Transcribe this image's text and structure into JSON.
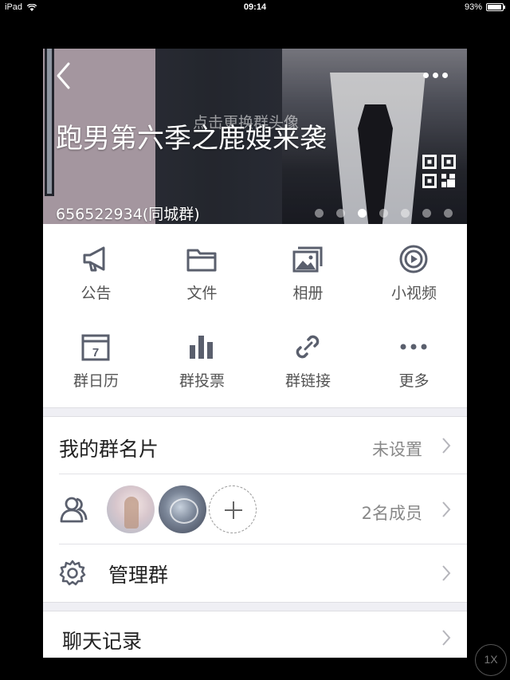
{
  "status_bar": {
    "device": "iPad",
    "time": "09:14",
    "battery_text": "93%",
    "battery_level": 0.93
  },
  "header": {
    "change_avatar_hint": "点击更换群头像",
    "group_name": "跑男第六季之鹿嫂来袭",
    "group_id": "656522934(同城群)",
    "carousel_page_count": 7,
    "carousel_active_index": 2
  },
  "features": [
    {
      "label": "公告",
      "icon": "megaphone-icon"
    },
    {
      "label": "文件",
      "icon": "folder-icon"
    },
    {
      "label": "相册",
      "icon": "photo-album-icon"
    },
    {
      "label": "小视频",
      "icon": "video-play-icon"
    },
    {
      "label": "群日历",
      "icon": "calendar-icon",
      "calendar_day": "7"
    },
    {
      "label": "群投票",
      "icon": "bar-chart-icon"
    },
    {
      "label": "群链接",
      "icon": "link-icon"
    },
    {
      "label": "更多",
      "icon": "more-dots-icon"
    }
  ],
  "my_card": {
    "title": "我的群名片",
    "value": "未设置"
  },
  "members": {
    "count_text": "2名成员",
    "icon": "members-icon"
  },
  "manage": {
    "title": "管理群",
    "icon": "gear-icon"
  },
  "chat_history": {
    "title": "聊天记录"
  },
  "zoom_button": {
    "label": "1X"
  },
  "colors": {
    "icon_gray": "#5a5f6d",
    "separator": "#efeff4",
    "secondary_text": "#888888"
  }
}
